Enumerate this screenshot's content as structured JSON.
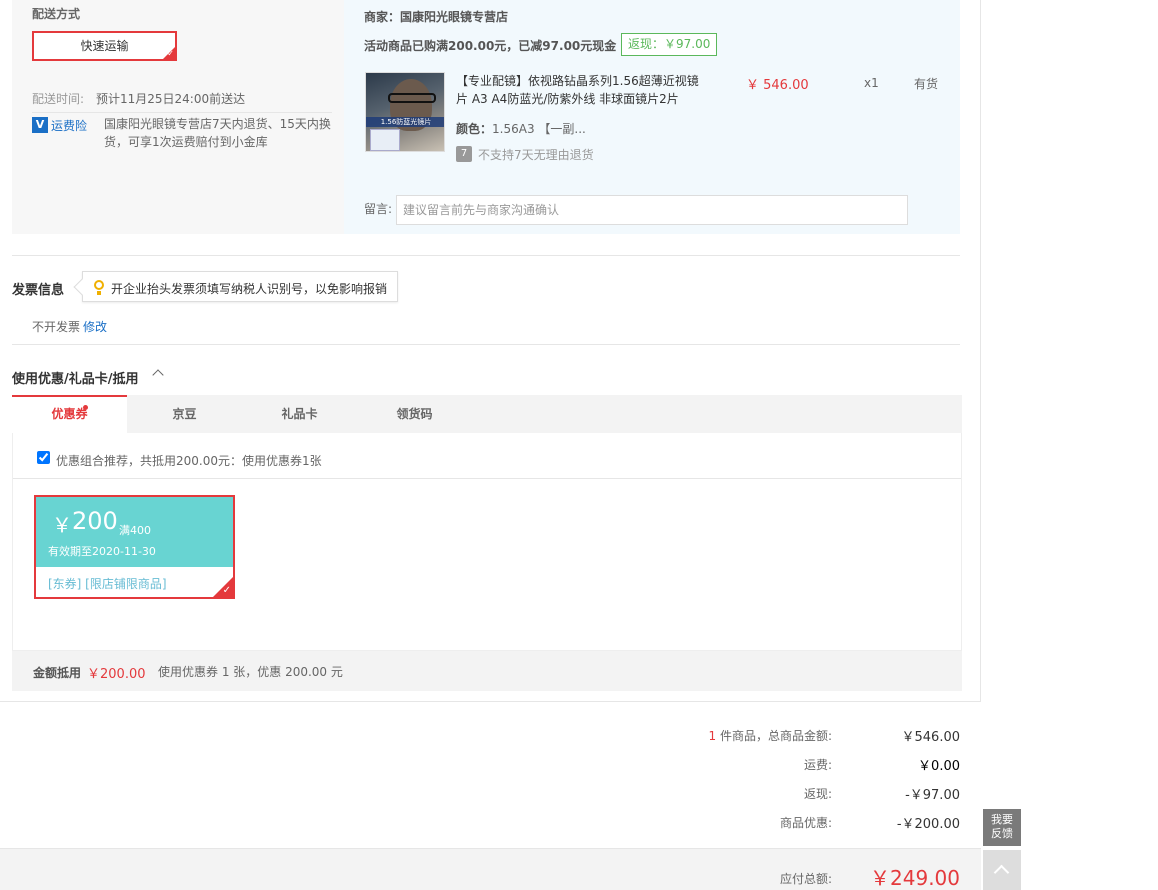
{
  "shipping": {
    "title": "配送方式",
    "method_label": "快速运输",
    "time_label": "配送时间:",
    "time_value": "预计11月25日24:00前送达",
    "insurance_link": "运费险",
    "insurance_desc": "国康阳光眼镜专营店7天内退货、15天内换货，可享1次运费赔付到小金库"
  },
  "merchant": {
    "name": "商家：国康阳光眼镜专营店",
    "promo": "活动商品已购满200.00元，已减97.00元现金",
    "cashback": "返现：￥97.00",
    "product": {
      "title": "【专业配镜】依视路钻晶系列1.56超薄近视镜片 A3 A4防蓝光/防紫外线 非球面镜片2片",
      "price": "￥ 546.00",
      "qty": "x1",
      "stock": "有货",
      "color_label": "颜色：",
      "color_value": "1.56A3 【一副...",
      "no_return": "不支持7天无理由退货",
      "img_caption": "1.56防蓝光镜片"
    },
    "message_label": "留言:",
    "message_placeholder": "建议留言前先与商家沟通确认"
  },
  "invoice": {
    "title": "发票信息",
    "tip": "开企业抬头发票须填写纳税人识别号，以免影响报销",
    "status": "不开发票",
    "edit": "修改"
  },
  "coupons": {
    "title": "使用优惠/礼品卡/抵用",
    "tabs": [
      "优惠券",
      "京豆",
      "礼品卡",
      "领货码"
    ],
    "recommend": "优惠组合推荐，共抵用200.00元：使用优惠券1张",
    "recommend_checked": true,
    "coupon": {
      "symbol": "￥",
      "amount": "200",
      "condition": "满400",
      "valid": "有效期至2020-11-30",
      "scope": "[东券]  [限店铺限商品]"
    },
    "summary_label": "金额抵用",
    "summary_amount": "￥200.00",
    "summary_desc": "使用优惠券 1 张，优惠 200.00 元"
  },
  "totals": {
    "item_count": "1",
    "items_label": " 件商品，总商品金额:",
    "items_value": "￥546.00",
    "shipping_label": "运费:",
    "shipping_value": "￥0.00",
    "cashback_label": "返现:",
    "cashback_value": "-￥97.00",
    "discount_label": "商品优惠:",
    "discount_value": "-￥200.00",
    "payable_label": "应付总额:",
    "payable_value": "￥249.00"
  },
  "side": {
    "feedback": "我要反馈"
  },
  "colors": {
    "accent": "#e4393c",
    "link": "#1a6fc6",
    "coupon": "#68d4d2",
    "cashback": "#5bb85b"
  }
}
